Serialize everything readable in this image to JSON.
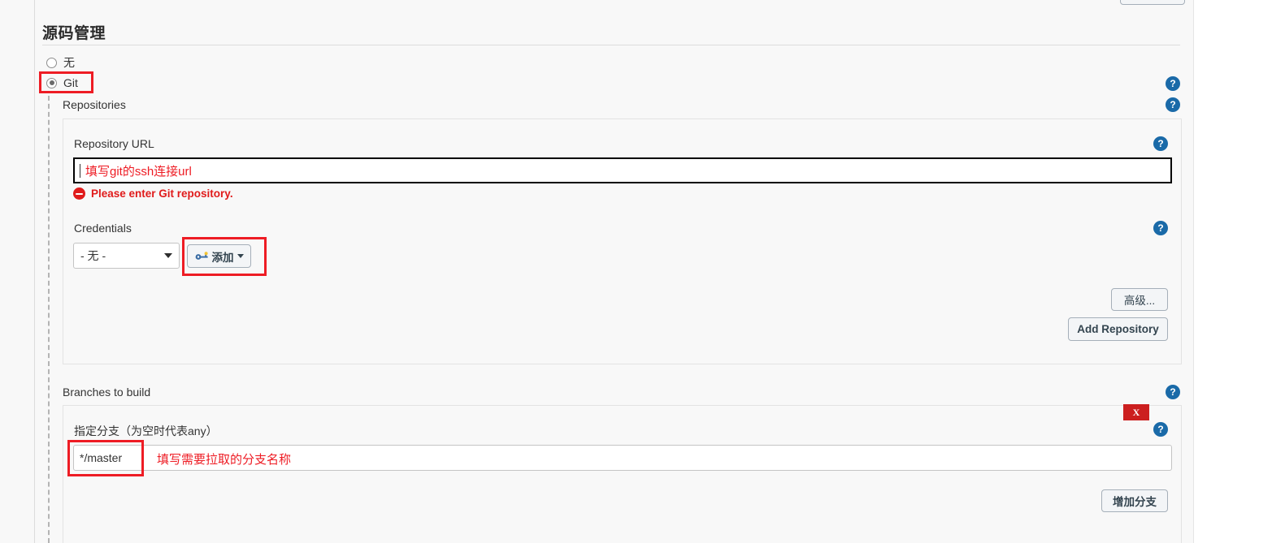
{
  "section": {
    "title": "源码管理"
  },
  "scm_options": [
    {
      "label": "无",
      "checked": false
    },
    {
      "label": "Git",
      "checked": true
    }
  ],
  "repositories": {
    "group_label": "Repositories",
    "repo_url": {
      "label": "Repository URL",
      "value": "",
      "annotation": "填写git的ssh连接url",
      "error": "Please enter Git repository.",
      "error_icon": "error-circle-icon"
    },
    "credentials": {
      "label": "Credentials",
      "selected": "- 无 -",
      "add_button": "添加",
      "add_button_icon": "key-icon",
      "caret_icon": "chevron-down-icon"
    },
    "advanced_button": "高级...",
    "add_repository_button": "Add Repository"
  },
  "branches": {
    "group_label": "Branches to build",
    "row": {
      "label": "指定分支（为空时代表any）",
      "value": "*/master",
      "annotation": "填写需要拉取的分支名称",
      "delete_button": "X"
    },
    "add_branch_button": "增加分支"
  },
  "help_icon": "?",
  "colors": {
    "annotation_red": "#ee1c24",
    "error_red": "#e01b1b",
    "help_blue": "#1a6aa8",
    "delete_red": "#cc1f1f",
    "page_background": "#f8f8f8"
  }
}
